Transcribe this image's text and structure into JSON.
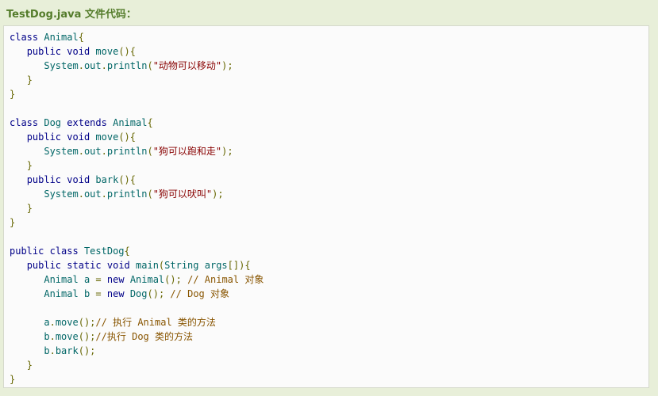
{
  "heading": "TestDog.java 文件代码：",
  "code": {
    "lines": [
      [
        [
          "kw",
          "class"
        ],
        [
          "pln",
          " "
        ],
        [
          "typ",
          "Animal"
        ],
        [
          "pun",
          "{"
        ]
      ],
      [
        [
          "pln",
          "   "
        ],
        [
          "kw",
          "public"
        ],
        [
          "pln",
          " "
        ],
        [
          "kw",
          "void"
        ],
        [
          "pln",
          " "
        ],
        [
          "typ",
          "move"
        ],
        [
          "pun",
          "(){"
        ]
      ],
      [
        [
          "pln",
          "      "
        ],
        [
          "typ",
          "System"
        ],
        [
          "pun",
          "."
        ],
        [
          "typ",
          "out"
        ],
        [
          "pun",
          "."
        ],
        [
          "typ",
          "println"
        ],
        [
          "pun",
          "("
        ],
        [
          "str",
          "\"动物可以移动\""
        ],
        [
          "pun",
          ");"
        ]
      ],
      [
        [
          "pln",
          "   "
        ],
        [
          "pun",
          "}"
        ]
      ],
      [
        [
          "pun",
          "}"
        ]
      ],
      [
        [
          "pln",
          ""
        ]
      ],
      [
        [
          "kw",
          "class"
        ],
        [
          "pln",
          " "
        ],
        [
          "typ",
          "Dog"
        ],
        [
          "pln",
          " "
        ],
        [
          "kw",
          "extends"
        ],
        [
          "pln",
          " "
        ],
        [
          "typ",
          "Animal"
        ],
        [
          "pun",
          "{"
        ]
      ],
      [
        [
          "pln",
          "   "
        ],
        [
          "kw",
          "public"
        ],
        [
          "pln",
          " "
        ],
        [
          "kw",
          "void"
        ],
        [
          "pln",
          " "
        ],
        [
          "typ",
          "move"
        ],
        [
          "pun",
          "(){"
        ]
      ],
      [
        [
          "pln",
          "      "
        ],
        [
          "typ",
          "System"
        ],
        [
          "pun",
          "."
        ],
        [
          "typ",
          "out"
        ],
        [
          "pun",
          "."
        ],
        [
          "typ",
          "println"
        ],
        [
          "pun",
          "("
        ],
        [
          "str",
          "\"狗可以跑和走\""
        ],
        [
          "pun",
          ");"
        ]
      ],
      [
        [
          "pln",
          "   "
        ],
        [
          "pun",
          "}"
        ]
      ],
      [
        [
          "pln",
          "   "
        ],
        [
          "kw",
          "public"
        ],
        [
          "pln",
          " "
        ],
        [
          "kw",
          "void"
        ],
        [
          "pln",
          " "
        ],
        [
          "typ",
          "bark"
        ],
        [
          "pun",
          "(){"
        ]
      ],
      [
        [
          "pln",
          "      "
        ],
        [
          "typ",
          "System"
        ],
        [
          "pun",
          "."
        ],
        [
          "typ",
          "out"
        ],
        [
          "pun",
          "."
        ],
        [
          "typ",
          "println"
        ],
        [
          "pun",
          "("
        ],
        [
          "str",
          "\"狗可以吠叫\""
        ],
        [
          "pun",
          ");"
        ]
      ],
      [
        [
          "pln",
          "   "
        ],
        [
          "pun",
          "}"
        ]
      ],
      [
        [
          "pun",
          "}"
        ]
      ],
      [
        [
          "pln",
          ""
        ]
      ],
      [
        [
          "kw",
          "public"
        ],
        [
          "pln",
          " "
        ],
        [
          "kw",
          "class"
        ],
        [
          "pln",
          " "
        ],
        [
          "typ",
          "TestDog"
        ],
        [
          "pun",
          "{"
        ]
      ],
      [
        [
          "pln",
          "   "
        ],
        [
          "kw",
          "public"
        ],
        [
          "pln",
          " "
        ],
        [
          "kw",
          "static"
        ],
        [
          "pln",
          " "
        ],
        [
          "kw",
          "void"
        ],
        [
          "pln",
          " "
        ],
        [
          "typ",
          "main"
        ],
        [
          "pun",
          "("
        ],
        [
          "typ",
          "String"
        ],
        [
          "pln",
          " "
        ],
        [
          "typ",
          "args"
        ],
        [
          "pun",
          "[]){"
        ]
      ],
      [
        [
          "pln",
          "      "
        ],
        [
          "typ",
          "Animal"
        ],
        [
          "pln",
          " "
        ],
        [
          "typ",
          "a"
        ],
        [
          "pln",
          " "
        ],
        [
          "pun",
          "="
        ],
        [
          "pln",
          " "
        ],
        [
          "kw",
          "new"
        ],
        [
          "pln",
          " "
        ],
        [
          "typ",
          "Animal"
        ],
        [
          "pun",
          "();"
        ],
        [
          "pln",
          " "
        ],
        [
          "com",
          "// Animal 对象"
        ]
      ],
      [
        [
          "pln",
          "      "
        ],
        [
          "typ",
          "Animal"
        ],
        [
          "pln",
          " "
        ],
        [
          "typ",
          "b"
        ],
        [
          "pln",
          " "
        ],
        [
          "pun",
          "="
        ],
        [
          "pln",
          " "
        ],
        [
          "kw",
          "new"
        ],
        [
          "pln",
          " "
        ],
        [
          "typ",
          "Dog"
        ],
        [
          "pun",
          "();"
        ],
        [
          "pln",
          " "
        ],
        [
          "com",
          "// Dog 对象"
        ]
      ],
      [
        [
          "pln",
          ""
        ]
      ],
      [
        [
          "pln",
          "      "
        ],
        [
          "typ",
          "a"
        ],
        [
          "pun",
          "."
        ],
        [
          "typ",
          "move"
        ],
        [
          "pun",
          "();"
        ],
        [
          "com",
          "// 执行 Animal 类的方法"
        ]
      ],
      [
        [
          "pln",
          "      "
        ],
        [
          "typ",
          "b"
        ],
        [
          "pun",
          "."
        ],
        [
          "typ",
          "move"
        ],
        [
          "pun",
          "();"
        ],
        [
          "com",
          "//执行 Dog 类的方法"
        ]
      ],
      [
        [
          "pln",
          "      "
        ],
        [
          "typ",
          "b"
        ],
        [
          "pun",
          "."
        ],
        [
          "typ",
          "bark"
        ],
        [
          "pun",
          "();"
        ]
      ],
      [
        [
          "pln",
          "   "
        ],
        [
          "pun",
          "}"
        ]
      ],
      [
        [
          "pun",
          "}"
        ]
      ]
    ]
  },
  "colors": {
    "kw": "#000088",
    "typ": "#006666",
    "pln": "#000000",
    "pun": "#666600",
    "str": "#880000",
    "com": "#885500",
    "heading": "#547c2b",
    "page_bg": "#e8efd9",
    "code_bg": "#fbfbfb"
  }
}
